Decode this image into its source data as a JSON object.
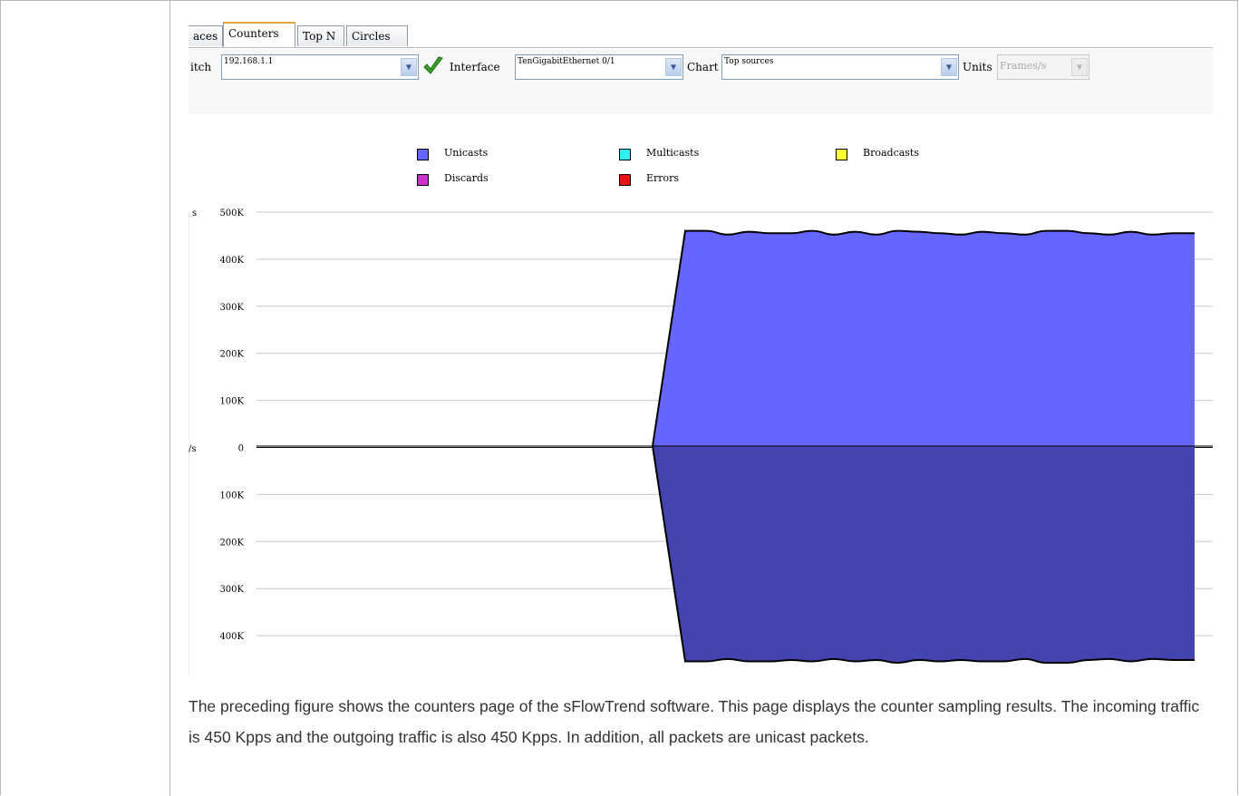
{
  "tabs": [
    {
      "label": "aces",
      "active": false
    },
    {
      "label": "Counters",
      "active": true
    },
    {
      "label": "Top N",
      "active": false
    },
    {
      "label": "Circles",
      "active": false
    }
  ],
  "toolbar": {
    "switch_label": "itch",
    "switch_value": "192.168.1.1",
    "interface_label": "Interface",
    "interface_value": "TenGigabitEthernet 0/1",
    "chart_label": "Chart",
    "chart_value": "Top sources",
    "units_label": "Units",
    "units_value": "Frames/s"
  },
  "chart_data": {
    "type": "area",
    "legend": [
      {
        "name": "Unicasts",
        "color": "#6666ff"
      },
      {
        "name": "Multicasts",
        "color": "#33eeee"
      },
      {
        "name": "Broadcasts",
        "color": "#ffff33"
      },
      {
        "name": "Discards",
        "color": "#cc33cc"
      },
      {
        "name": "Errors",
        "color": "#ee1111"
      }
    ],
    "ylabel_top_fragment": "s",
    "ylabel_mid_fragment": "/s",
    "ylim": [
      -500000,
      500000
    ],
    "yticks": [
      "500K",
      "400K",
      "300K",
      "200K",
      "100K",
      "0",
      "100K",
      "200K",
      "300K",
      "400K",
      "500K"
    ],
    "series": [
      {
        "name": "Unicasts",
        "direction": "in",
        "color": "#6666ff",
        "x": [
          0,
          1,
          2,
          3,
          4,
          5,
          6,
          7,
          8,
          9,
          10,
          11,
          12,
          13,
          14,
          15,
          16,
          17,
          18,
          19,
          20,
          21,
          22,
          23,
          24,
          25,
          26,
          27,
          28,
          29,
          30,
          31,
          32,
          33,
          34,
          35,
          36,
          37,
          38,
          39,
          40,
          41,
          42,
          43,
          44,
          45,
          46,
          47,
          48,
          49,
          50,
          51,
          52,
          53,
          54,
          55,
          56,
          57,
          58,
          59
        ],
        "values": [
          0,
          0,
          0,
          0,
          0,
          0,
          0,
          0,
          0,
          0,
          0,
          0,
          0,
          0,
          0,
          0,
          0,
          0,
          0,
          0,
          0,
          0,
          0,
          0,
          0,
          0,
          0,
          0,
          0,
          0,
          0,
          0,
          0,
          0,
          0,
          0,
          0,
          0,
          0,
          0,
          0,
          0,
          0,
          0,
          0,
          0,
          0,
          0,
          0,
          0,
          0,
          0,
          0,
          0,
          0,
          0,
          0,
          0,
          0,
          0
        ]
      },
      {
        "name": "Unicasts",
        "direction": "out",
        "color": "#4444b0",
        "values": []
      }
    ],
    "in_values": [
      0,
      460000,
      460000,
      452000,
      458000,
      455000,
      455000,
      460000,
      452000,
      458000,
      452000,
      460000,
      458000,
      455000,
      452000,
      458000,
      455000,
      452000,
      460000,
      460000,
      455000,
      452000,
      458000,
      452000,
      455000,
      455000
    ],
    "out_values": [
      0,
      455000,
      455000,
      450000,
      455000,
      455000,
      452000,
      455000,
      450000,
      455000,
      452000,
      458000,
      452000,
      455000,
      452000,
      455000,
      455000,
      450000,
      458000,
      458000,
      452000,
      450000,
      455000,
      450000,
      452000,
      452000
    ]
  },
  "caption": "The preceding figure shows the counters page of the sFlowTrend software. This page displays the counter sampling results. The incoming traffic is 450 Kpps and the outgoing traffic is also 450 Kpps. In addition, all packets are unicast packets.",
  "colors": {
    "in_fill": "#6666ff",
    "out_fill": "#4444b0",
    "tab_accent": "#e9a53a",
    "check": "#3aa12b"
  }
}
